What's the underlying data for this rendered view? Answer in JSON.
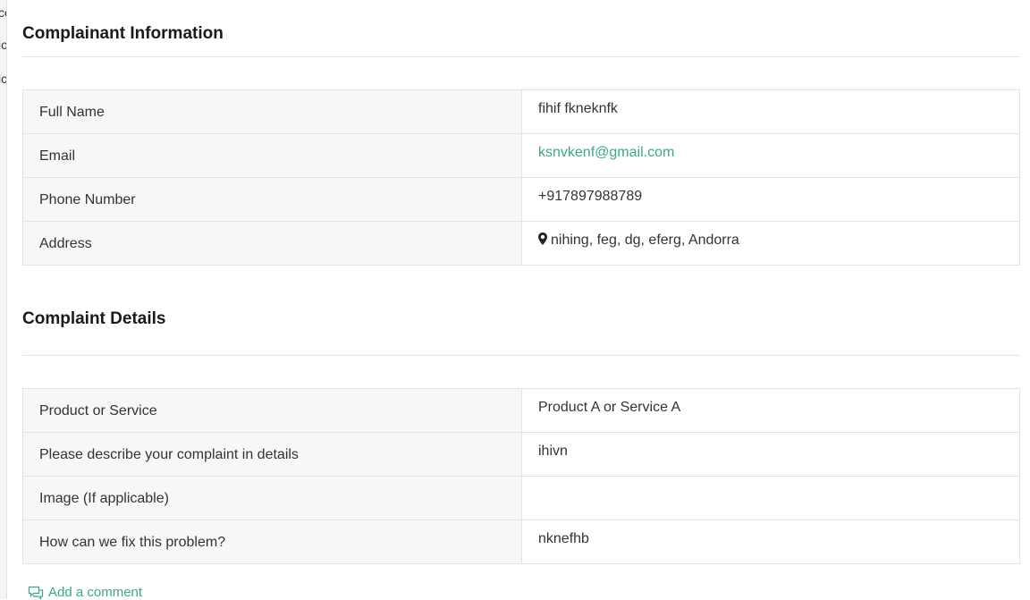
{
  "left_strip": {
    "chars": [
      "ce",
      "ic",
      "ic"
    ]
  },
  "sections": {
    "complainant": {
      "title": "Complainant Information",
      "rows": [
        {
          "label": "Full Name",
          "value": "fihif fkneknfk"
        },
        {
          "label": "Email",
          "value": "ksnvkenf@gmail.com"
        },
        {
          "label": "Phone Number",
          "value": "+917897988789"
        },
        {
          "label": "Address",
          "value": "nihing, feg, dg, eferg, Andorra"
        }
      ]
    },
    "complaint": {
      "title": "Complaint Details",
      "rows": [
        {
          "label": "Product or Service",
          "value": "Product A or Service A"
        },
        {
          "label": "Please describe your complaint in details",
          "value": "ihivn"
        },
        {
          "label": "Image (If applicable)",
          "value": ""
        },
        {
          "label": "How can we fix this problem?",
          "value": "nknefhb"
        }
      ]
    }
  },
  "actions": {
    "add_comment": "Add a comment"
  },
  "colors": {
    "link": "#3aa88c",
    "label_bg": "#f6f7f7",
    "border": "#e3e3e3"
  },
  "icons": {
    "address": "map-pin-icon",
    "comment": "comment-icon"
  }
}
